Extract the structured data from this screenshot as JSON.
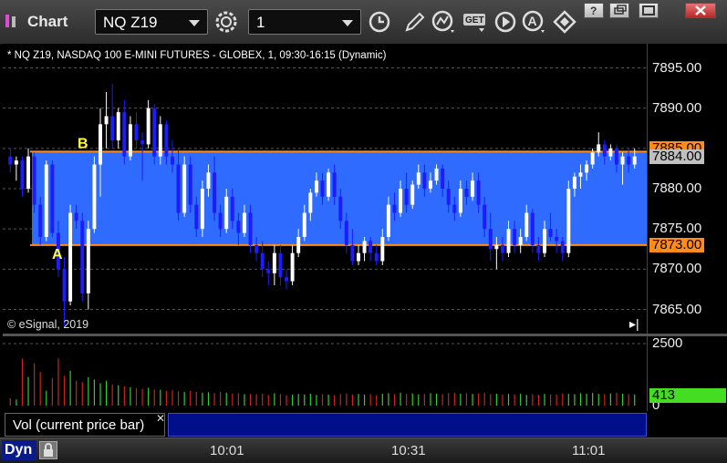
{
  "window": {
    "title": "Chart",
    "symbol": "NQ Z19",
    "interval": "1"
  },
  "toolbar_icons": [
    "settings-icon",
    "clock-icon",
    "pencil-icon",
    "study-icon",
    "get-icon",
    "play-icon",
    "alert-icon",
    "cursor-icon"
  ],
  "chart": {
    "header": "* NQ Z19, NASDAQ 100 E-MINI FUTURES - GLOBEX, 1, 09:30-16:15 (Dynamic)",
    "copyright": "© eSignal, 2019",
    "price_ticks": [
      "7895.00",
      "7890.00",
      "7885.00",
      "7880.00",
      "7875.00",
      "7870.00",
      "7865.00"
    ],
    "last_price": "7884.00",
    "level_a": "7873.00",
    "level_b_partial": "7885.00",
    "label_a": "A",
    "label_b": "B",
    "time_ticks": [
      "10:01",
      "10:31",
      "11:01"
    ],
    "colors": {
      "band": "#2f6bff",
      "level": "#ff8c1a",
      "up_candle": "#ffffff",
      "down_candle": "#1c1cff",
      "up_vol": "#33cc33",
      "down_vol": "#cc2222",
      "last_price_box": "#c0c0c0"
    }
  },
  "chart_data": {
    "type": "candlestick",
    "ylim": [
      7862,
      7898
    ],
    "x_labels": [
      "10:01",
      "10:31",
      "11:01"
    ],
    "bands": [
      {
        "from": 7873.0,
        "to": 7884.6
      }
    ],
    "lines": [
      {
        "label": "A",
        "value": 7873.0
      },
      {
        "label": "B",
        "value": 7884.6
      }
    ],
    "candles": [
      [
        7884.0,
        7885.0,
        7882.0,
        7883.0
      ],
      [
        7883.0,
        7884.0,
        7881.0,
        7883.5
      ],
      [
        7883.5,
        7884.0,
        7879.0,
        7880.0
      ],
      [
        7880.0,
        7885.0,
        7879.5,
        7884.0
      ],
      [
        7884.0,
        7884.5,
        7877.0,
        7878.0
      ],
      [
        7878.0,
        7879.0,
        7873.0,
        7874.0
      ],
      [
        7874.0,
        7883.5,
        7873.5,
        7883.0
      ],
      [
        7883.0,
        7883.5,
        7874.0,
        7874.5
      ],
      [
        7874.5,
        7876.0,
        7869.0,
        7870.0
      ],
      [
        7870.0,
        7871.5,
        7863.0,
        7866.0
      ],
      [
        7866.0,
        7878.0,
        7865.5,
        7877.0
      ],
      [
        7877.0,
        7878.0,
        7875.0,
        7876.0
      ],
      [
        7876.0,
        7877.0,
        7866.0,
        7867.0
      ],
      [
        7867.0,
        7876.0,
        7865.0,
        7875.0
      ],
      [
        7875.0,
        7884.0,
        7874.5,
        7883.0
      ],
      [
        7883.0,
        7890.0,
        7879.0,
        7888.0
      ],
      [
        7888.0,
        7892.0,
        7885.0,
        7889.0
      ],
      [
        7889.0,
        7893.0,
        7885.0,
        7886.0
      ],
      [
        7886.0,
        7890.0,
        7885.0,
        7889.5
      ],
      [
        7889.5,
        7891.0,
        7883.0,
        7884.0
      ],
      [
        7884.0,
        7889.0,
        7883.5,
        7888.0
      ],
      [
        7888.0,
        7889.5,
        7885.0,
        7886.0
      ],
      [
        7886.0,
        7887.0,
        7881.0,
        7885.5
      ],
      [
        7885.5,
        7891.0,
        7885.0,
        7890.0
      ],
      [
        7890.0,
        7890.5,
        7883.0,
        7884.0
      ],
      [
        7884.0,
        7889.0,
        7883.0,
        7888.0
      ],
      [
        7888.0,
        7888.5,
        7883.0,
        7884.0
      ],
      [
        7884.0,
        7886.0,
        7882.0,
        7883.0
      ],
      [
        7883.0,
        7885.0,
        7876.0,
        7877.0
      ],
      [
        7877.0,
        7884.0,
        7876.5,
        7883.0
      ],
      [
        7883.0,
        7884.0,
        7877.0,
        7878.0
      ],
      [
        7878.0,
        7879.0,
        7874.0,
        7875.0
      ],
      [
        7875.0,
        7881.0,
        7874.0,
        7880.0
      ],
      [
        7880.0,
        7883.0,
        7879.0,
        7882.0
      ],
      [
        7882.0,
        7884.0,
        7876.0,
        7877.0
      ],
      [
        7877.0,
        7878.0,
        7874.0,
        7875.0
      ],
      [
        7875.0,
        7880.0,
        7874.5,
        7879.0
      ],
      [
        7879.0,
        7880.0,
        7875.0,
        7876.0
      ],
      [
        7876.0,
        7877.0,
        7873.0,
        7874.5
      ],
      [
        7874.5,
        7878.0,
        7874.0,
        7877.0
      ],
      [
        7877.0,
        7878.0,
        7872.0,
        7873.0
      ],
      [
        7873.0,
        7874.0,
        7871.0,
        7872.0
      ],
      [
        7872.0,
        7873.5,
        7869.0,
        7870.0
      ],
      [
        7870.0,
        7871.0,
        7868.0,
        7869.5
      ],
      [
        7869.5,
        7873.0,
        7868.0,
        7872.0
      ],
      [
        7872.0,
        7873.0,
        7868.0,
        7869.0
      ],
      [
        7869.0,
        7870.0,
        7867.5,
        7868.5
      ],
      [
        7868.5,
        7873.0,
        7868.0,
        7872.0
      ],
      [
        7872.0,
        7875.0,
        7871.5,
        7874.0
      ],
      [
        7874.0,
        7878.0,
        7873.5,
        7877.0
      ],
      [
        7877.0,
        7880.0,
        7876.0,
        7879.5
      ],
      [
        7879.5,
        7882.0,
        7879.0,
        7881.0
      ],
      [
        7881.0,
        7882.0,
        7878.0,
        7879.0
      ],
      [
        7879.0,
        7882.5,
        7878.5,
        7882.0
      ],
      [
        7882.0,
        7883.0,
        7878.0,
        7879.0
      ],
      [
        7879.0,
        7880.0,
        7875.0,
        7876.0
      ],
      [
        7876.0,
        7877.0,
        7872.0,
        7873.0
      ],
      [
        7873.0,
        7875.0,
        7870.5,
        7871.0
      ],
      [
        7871.0,
        7873.0,
        7870.5,
        7872.0
      ],
      [
        7872.0,
        7874.0,
        7871.0,
        7873.5
      ],
      [
        7873.5,
        7874.0,
        7871.0,
        7872.0
      ],
      [
        7872.0,
        7873.0,
        7870.5,
        7871.0
      ],
      [
        7871.0,
        7875.0,
        7870.5,
        7874.0
      ],
      [
        7874.0,
        7879.0,
        7873.5,
        7878.0
      ],
      [
        7878.0,
        7879.5,
        7876.0,
        7877.0
      ],
      [
        7877.0,
        7881.0,
        7876.5,
        7880.0
      ],
      [
        7880.0,
        7882.0,
        7877.0,
        7878.0
      ],
      [
        7878.0,
        7881.0,
        7877.5,
        7880.5
      ],
      [
        7880.5,
        7883.0,
        7880.0,
        7882.0
      ],
      [
        7882.0,
        7883.0,
        7879.0,
        7880.0
      ],
      [
        7880.0,
        7882.0,
        7879.5,
        7881.0
      ],
      [
        7881.0,
        7883.0,
        7880.5,
        7882.5
      ],
      [
        7882.5,
        7883.0,
        7879.0,
        7880.0
      ],
      [
        7880.0,
        7881.0,
        7877.0,
        7878.0
      ],
      [
        7878.0,
        7879.0,
        7876.0,
        7877.0
      ],
      [
        7877.0,
        7881.0,
        7876.5,
        7880.0
      ],
      [
        7880.0,
        7881.0,
        7878.0,
        7879.0
      ],
      [
        7879.0,
        7882.0,
        7878.5,
        7881.0
      ],
      [
        7881.0,
        7882.0,
        7877.0,
        7878.0
      ],
      [
        7878.0,
        7879.0,
        7874.0,
        7875.0
      ],
      [
        7875.0,
        7877.0,
        7871.0,
        7872.5
      ],
      [
        7872.5,
        7874.0,
        7870.0,
        7873.0
      ],
      [
        7873.0,
        7874.0,
        7871.0,
        7872.0
      ],
      [
        7872.0,
        7876.0,
        7871.5,
        7875.0
      ],
      [
        7875.0,
        7876.0,
        7872.0,
        7873.0
      ],
      [
        7873.0,
        7875.0,
        7872.0,
        7874.0
      ],
      [
        7874.0,
        7878.0,
        7873.5,
        7877.0
      ],
      [
        7877.0,
        7877.5,
        7872.0,
        7873.0
      ],
      [
        7873.0,
        7874.0,
        7871.0,
        7872.0
      ],
      [
        7872.0,
        7876.0,
        7871.5,
        7875.0
      ],
      [
        7875.0,
        7877.0,
        7873.5,
        7874.0
      ],
      [
        7874.0,
        7875.0,
        7872.0,
        7873.5
      ],
      [
        7873.5,
        7874.0,
        7871.0,
        7872.0
      ],
      [
        7872.0,
        7881.0,
        7871.5,
        7880.0
      ],
      [
        7880.0,
        7882.0,
        7879.0,
        7881.5
      ],
      [
        7881.5,
        7883.0,
        7880.0,
        7882.0
      ],
      [
        7882.0,
        7883.5,
        7881.0,
        7883.0
      ],
      [
        7883.0,
        7885.0,
        7882.5,
        7884.5
      ],
      [
        7884.5,
        7887.0,
        7884.0,
        7885.5
      ],
      [
        7885.5,
        7886.0,
        7883.0,
        7884.0
      ],
      [
        7884.0,
        7885.5,
        7883.5,
        7885.0
      ],
      [
        7885.0,
        7885.5,
        7882.0,
        7883.0
      ],
      [
        7883.0,
        7884.5,
        7880.5,
        7884.0
      ],
      [
        7884.0,
        7885.0,
        7882.0,
        7883.0
      ],
      [
        7883.0,
        7885.0,
        7882.5,
        7884.0
      ]
    ],
    "volume_ylim": [
      0,
      2500
    ],
    "volume_ticks": [
      "2500",
      "0"
    ],
    "current_volume": "413",
    "volume": [
      300,
      250,
      1900,
      1150,
      1700,
      1350,
      600,
      1100,
      1900,
      1200,
      1400,
      1000,
      950,
      1150,
      1050,
      900,
      1000,
      850,
      820,
      780,
      740,
      700,
      680,
      720,
      650,
      640,
      600,
      620,
      580,
      550,
      600,
      560,
      520,
      540,
      500,
      560,
      520,
      480,
      500,
      460,
      470,
      450,
      480,
      430,
      500,
      460,
      420,
      440,
      470,
      450,
      480,
      430,
      460,
      440,
      420,
      460,
      490,
      450,
      470,
      440,
      460,
      430,
      480,
      500,
      460,
      520,
      470,
      490,
      450,
      470,
      500,
      480,
      460,
      500,
      520,
      480,
      500,
      470,
      490,
      510,
      460,
      480,
      440,
      470,
      450,
      480,
      430,
      460,
      440,
      470,
      450,
      440,
      490,
      470,
      460,
      500,
      480,
      510,
      470,
      460,
      490,
      520,
      480,
      460,
      450
    ]
  }
}
